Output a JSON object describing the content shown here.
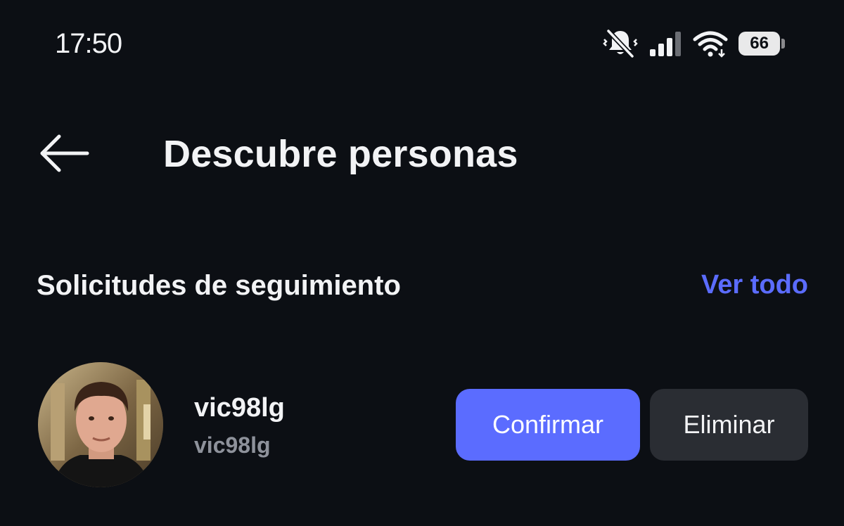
{
  "status_bar": {
    "time": "17:50",
    "icons": [
      "bell-muted-icon",
      "signal-icon",
      "wifi-icon",
      "battery-icon"
    ],
    "battery_level": "66"
  },
  "header": {
    "back_icon": "arrow-left-icon",
    "title": "Descubre personas"
  },
  "section": {
    "title": "Solicitudes de seguimiento",
    "see_all_label": "Ver todo"
  },
  "requests": [
    {
      "username": "vic98lg",
      "handle": "vic98lg",
      "confirm_label": "Confirmar",
      "delete_label": "Eliminar"
    }
  ],
  "colors": {
    "background": "#0c0f14",
    "accent": "#5b6cff",
    "secondary_button": "#2a2d33",
    "muted_text": "#8e929b"
  }
}
